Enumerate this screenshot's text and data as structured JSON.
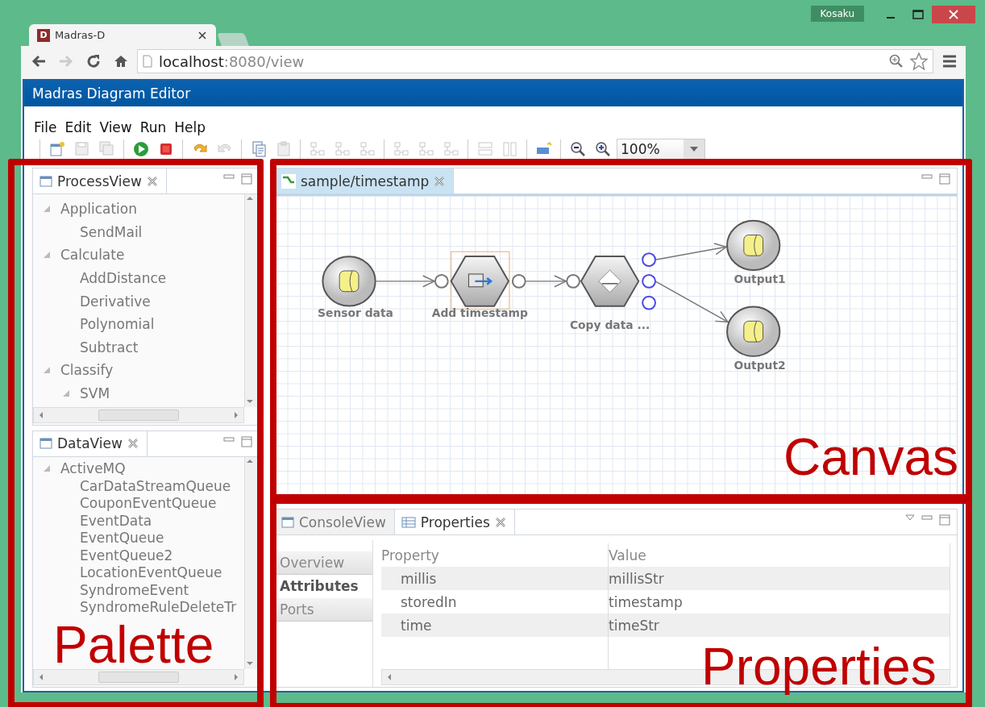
{
  "browser": {
    "user": "Kosaku",
    "tab": {
      "favicon": "D",
      "title": "Madras-D"
    },
    "address": {
      "host": "localhost",
      "rest": ":8080/view"
    }
  },
  "app": {
    "title": "Madras Diagram Editor",
    "menu": [
      "File",
      "Edit",
      "View",
      "Run",
      "Help"
    ],
    "zoom": "100%"
  },
  "process_view": {
    "title": "ProcessView",
    "tree": [
      {
        "label": "Application",
        "expanded": true,
        "children": [
          {
            "label": "SendMail"
          }
        ]
      },
      {
        "label": "Calculate",
        "expanded": true,
        "children": [
          {
            "label": "AddDistance"
          },
          {
            "label": "Derivative"
          },
          {
            "label": "Polynomial"
          },
          {
            "label": "Subtract"
          }
        ]
      },
      {
        "label": "Classify",
        "expanded": true,
        "children": [
          {
            "label": "SVM",
            "expanded": true
          }
        ]
      }
    ]
  },
  "data_view": {
    "title": "DataView",
    "tree": [
      {
        "label": "ActiveMQ",
        "expanded": true,
        "children": [
          {
            "label": "CarDataStreamQueue"
          },
          {
            "label": "CouponEventQueue"
          },
          {
            "label": "EventData"
          },
          {
            "label": "EventQueue"
          },
          {
            "label": "EventQueue2"
          },
          {
            "label": "LocationEventQueue"
          },
          {
            "label": "SyndromeEvent"
          },
          {
            "label": "SyndromeRuleDeleteTr"
          }
        ]
      }
    ]
  },
  "editor": {
    "tab": "sample/timestamp",
    "nodes": [
      {
        "kind": "data",
        "label": "Sensor data",
        "selected": false
      },
      {
        "kind": "process",
        "label": "Add timestamp",
        "selected": true
      },
      {
        "kind": "copy",
        "label": "Copy data ...",
        "selected": false
      },
      {
        "kind": "data",
        "label": "Output1",
        "selected": false
      },
      {
        "kind": "data",
        "label": "Output2",
        "selected": false
      }
    ]
  },
  "bottom_panel": {
    "tabs": [
      {
        "label": "ConsoleView",
        "selected": false
      },
      {
        "label": "Properties",
        "selected": true
      }
    ],
    "sections": [
      {
        "label": "Overview",
        "selected": false
      },
      {
        "label": "Attributes",
        "selected": true
      },
      {
        "label": "Ports",
        "selected": false
      }
    ],
    "columns": [
      "Property",
      "Value"
    ],
    "rows": [
      {
        "property": "millis",
        "value": "millisStr"
      },
      {
        "property": "storedIn",
        "value": "timestamp"
      },
      {
        "property": "time",
        "value": "timeStr"
      }
    ]
  },
  "annotations": [
    {
      "label": "Palette"
    },
    {
      "label": "Canvas"
    },
    {
      "label": "Properties"
    }
  ]
}
